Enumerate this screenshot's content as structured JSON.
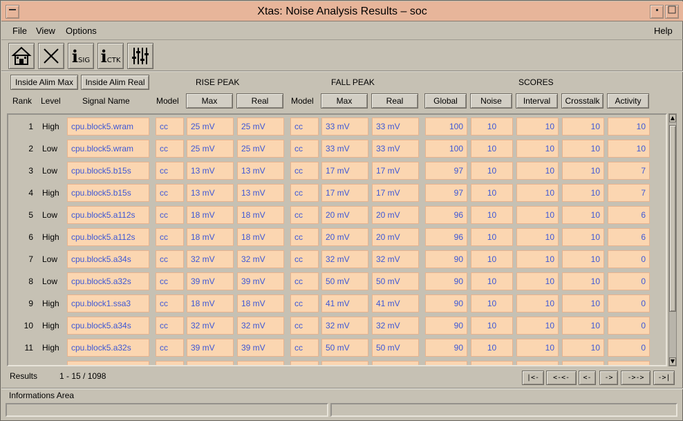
{
  "window": {
    "title": "Xtas: Noise Analysis Results – soc"
  },
  "menu": {
    "file": "File",
    "view": "View",
    "options": "Options",
    "help": "Help"
  },
  "toolbar": {
    "tools": [
      {
        "icon": "home-icon"
      },
      {
        "icon": "close-icon"
      },
      {
        "icon": "signal-info-icon",
        "letter": "i",
        "sub": "SIG"
      },
      {
        "icon": "crosstalk-info-icon",
        "letter": "i",
        "sub": "CTK"
      },
      {
        "icon": "sliders-icon"
      }
    ]
  },
  "buttons": {
    "inside_alim_max": "Inside Alim Max",
    "inside_alim_real": "Inside Alim Real"
  },
  "group_headers": {
    "rise_peak": "RISE PEAK",
    "fall_peak": "FALL PEAK",
    "scores": "SCORES"
  },
  "columns": {
    "rank": "Rank",
    "level": "Level",
    "signal_name": "Signal Name",
    "rise_model": "Model",
    "rise_max": "Max",
    "rise_real": "Real",
    "fall_model": "Model",
    "fall_max": "Max",
    "fall_real": "Real",
    "global": "Global",
    "noise": "Noise",
    "interval": "Interval",
    "crosstalk": "Crosstalk",
    "activity": "Activity"
  },
  "rows": [
    {
      "rank": "1",
      "level": "High",
      "signal": "cpu.block5.wram",
      "rise_model": "cc",
      "rise_max": "25 mV",
      "rise_real": "25 mV",
      "fall_model": "cc",
      "fall_max": "33 mV",
      "fall_real": "33 mV",
      "global": "100",
      "noise": "10",
      "interval": "10",
      "crosstalk": "10",
      "activity": "10"
    },
    {
      "rank": "2",
      "level": "Low",
      "signal": "cpu.block5.wram",
      "rise_model": "cc",
      "rise_max": "25 mV",
      "rise_real": "25 mV",
      "fall_model": "cc",
      "fall_max": "33 mV",
      "fall_real": "33 mV",
      "global": "100",
      "noise": "10",
      "interval": "10",
      "crosstalk": "10",
      "activity": "10"
    },
    {
      "rank": "3",
      "level": "Low",
      "signal": "cpu.block5.b15s",
      "rise_model": "cc",
      "rise_max": "13 mV",
      "rise_real": "13 mV",
      "fall_model": "cc",
      "fall_max": "17 mV",
      "fall_real": "17 mV",
      "global": "97",
      "noise": "10",
      "interval": "10",
      "crosstalk": "10",
      "activity": "7"
    },
    {
      "rank": "4",
      "level": "High",
      "signal": "cpu.block5.b15s",
      "rise_model": "cc",
      "rise_max": "13 mV",
      "rise_real": "13 mV",
      "fall_model": "cc",
      "fall_max": "17 mV",
      "fall_real": "17 mV",
      "global": "97",
      "noise": "10",
      "interval": "10",
      "crosstalk": "10",
      "activity": "7"
    },
    {
      "rank": "5",
      "level": "Low",
      "signal": "cpu.block5.a112s",
      "rise_model": "cc",
      "rise_max": "18 mV",
      "rise_real": "18 mV",
      "fall_model": "cc",
      "fall_max": "20 mV",
      "fall_real": "20 mV",
      "global": "96",
      "noise": "10",
      "interval": "10",
      "crosstalk": "10",
      "activity": "6"
    },
    {
      "rank": "6",
      "level": "High",
      "signal": "cpu.block5.a112s",
      "rise_model": "cc",
      "rise_max": "18 mV",
      "rise_real": "18 mV",
      "fall_model": "cc",
      "fall_max": "20 mV",
      "fall_real": "20 mV",
      "global": "96",
      "noise": "10",
      "interval": "10",
      "crosstalk": "10",
      "activity": "6"
    },
    {
      "rank": "7",
      "level": "Low",
      "signal": "cpu.block5.a34s",
      "rise_model": "cc",
      "rise_max": "32 mV",
      "rise_real": "32 mV",
      "fall_model": "cc",
      "fall_max": "32 mV",
      "fall_real": "32 mV",
      "global": "90",
      "noise": "10",
      "interval": "10",
      "crosstalk": "10",
      "activity": "0"
    },
    {
      "rank": "8",
      "level": "Low",
      "signal": "cpu.block5.a32s",
      "rise_model": "cc",
      "rise_max": "39 mV",
      "rise_real": "39 mV",
      "fall_model": "cc",
      "fall_max": "50 mV",
      "fall_real": "50 mV",
      "global": "90",
      "noise": "10",
      "interval": "10",
      "crosstalk": "10",
      "activity": "0"
    },
    {
      "rank": "9",
      "level": "High",
      "signal": "cpu.block1.ssa3",
      "rise_model": "cc",
      "rise_max": "18 mV",
      "rise_real": "18 mV",
      "fall_model": "cc",
      "fall_max": "41 mV",
      "fall_real": "41 mV",
      "global": "90",
      "noise": "10",
      "interval": "10",
      "crosstalk": "10",
      "activity": "0"
    },
    {
      "rank": "10",
      "level": "High",
      "signal": "cpu.block5.a34s",
      "rise_model": "cc",
      "rise_max": "32 mV",
      "rise_real": "32 mV",
      "fall_model": "cc",
      "fall_max": "32 mV",
      "fall_real": "32 mV",
      "global": "90",
      "noise": "10",
      "interval": "10",
      "crosstalk": "10",
      "activity": "0"
    },
    {
      "rank": "11",
      "level": "High",
      "signal": "cpu.block5.a32s",
      "rise_model": "cc",
      "rise_max": "39 mV",
      "rise_real": "39 mV",
      "fall_model": "cc",
      "fall_max": "50 mV",
      "fall_real": "50 mV",
      "global": "90",
      "noise": "10",
      "interval": "10",
      "crosstalk": "10",
      "activity": "0"
    }
  ],
  "results": {
    "label": "Results",
    "range": "1 - 15 / 1098"
  },
  "pager": {
    "first": "|<-",
    "prev_page": "<-<-",
    "prev": "<-",
    "next": "->",
    "next_page": "->->",
    "last": "->|"
  },
  "info_area": {
    "label": "Informations Area"
  },
  "colors": {
    "cell_bg": "#fbd6b1",
    "cell_text": "#3d57d6",
    "title_bg": "#e7b59a",
    "window_bg": "#c6c1b4"
  }
}
